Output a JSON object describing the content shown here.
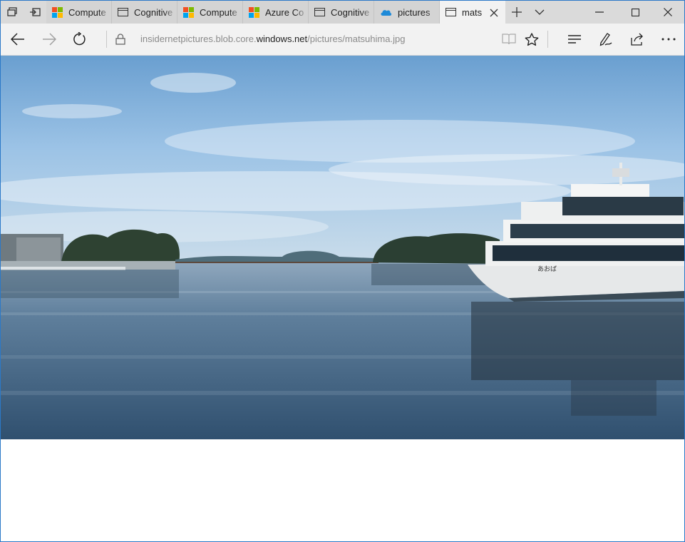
{
  "browser": {
    "tabs": [
      {
        "label": "Compute",
        "icon": "microsoft-logo-icon"
      },
      {
        "label": "Cognitive",
        "icon": "page-icon"
      },
      {
        "label": "Compute",
        "icon": "microsoft-logo-icon"
      },
      {
        "label": "Azure Co",
        "icon": "microsoft-logo-icon"
      },
      {
        "label": "Cognitive",
        "icon": "page-icon"
      },
      {
        "label": "pictures",
        "icon": "cloud-icon"
      },
      {
        "label": "mats",
        "icon": "page-icon",
        "active": true
      }
    ],
    "address": {
      "prefix": "insidernetpictures.blob.core.",
      "domain": "windows.net",
      "path": "/pictures/matsuhima.jpg"
    }
  },
  "content": {
    "image_subject": "harbor-photo",
    "boat_text": "あおば"
  },
  "colors": {
    "accent_border": "#2b79c8",
    "tabbar_bg": "#dadada",
    "navbar_bg": "#f2f2f2",
    "ms_red": "#f25022",
    "ms_green": "#7fba00",
    "ms_blue": "#00a4ef",
    "ms_yellow": "#ffb900",
    "cloud_blue": "#1e8ad8"
  }
}
